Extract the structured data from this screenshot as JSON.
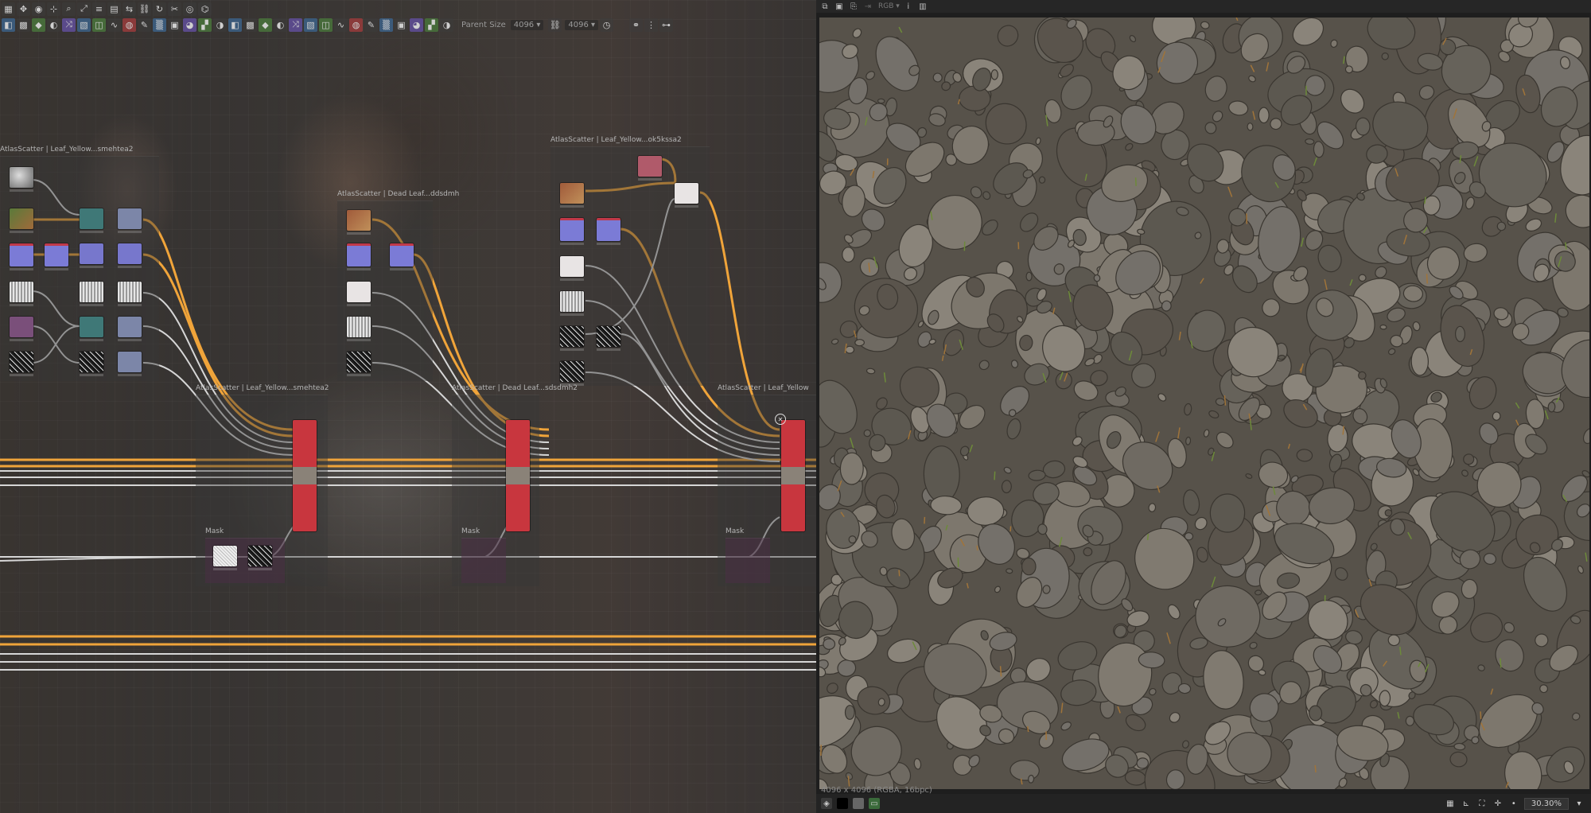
{
  "graph": {
    "toolbar": {
      "row1_icons": [
        "layout-icon",
        "move-icon",
        "camera-icon",
        "bookmark-icon",
        "search-icon",
        "fit-icon",
        "align-icon",
        "grid-icon",
        "arrow-icon",
        "link-icon",
        "refresh-icon",
        "cut-icon",
        "graph-icon",
        "pipe-icon"
      ],
      "row2_icons": [
        "image-icon",
        "texture-icon",
        "fill-icon",
        "blend-icon",
        "shuffle-icon",
        "gradient-icon",
        "levels-icon",
        "curve-icon",
        "warp-icon",
        "brush-icon",
        "noise-icon",
        "tile-icon",
        "color-icon",
        "pattern-icon",
        "hsl-icon",
        "mask-icon",
        "output-icon",
        "pixel-icon",
        "edit-icon",
        "text-icon",
        "frame-icon",
        "comment-icon",
        "pin-icon",
        "hdr-icon",
        "fx-icon",
        "sf-icon",
        "histogram-icon",
        "sharpen-icon",
        "blur-icon",
        "bake-icon"
      ],
      "parent_size_label": "Parent Size",
      "parent_size_value": "4096",
      "size_value": "4096"
    },
    "frames": [
      {
        "title": "AtlasScatter | Leaf_Yellow...smehtea2"
      },
      {
        "title": "AtlasScatter | Dead Leaf...ddsdmh"
      },
      {
        "title": "AtlasScatter | Leaf_Yellow...ok5kssa2"
      },
      {
        "title": "AtlasScatter | Leaf_Yellow...smehtea2"
      },
      {
        "title": "AtlasScatter | Dead Leaf...sdsdmh2"
      },
      {
        "title": "AtlasScatter | Leaf_Yellow"
      }
    ],
    "mask_frames": [
      {
        "title": "Mask"
      },
      {
        "title": "Mask"
      },
      {
        "title": "Mask"
      }
    ]
  },
  "viewer": {
    "toolbar_icons": [
      "copy-icon",
      "save-icon",
      "paste-icon",
      "export-icon",
      "channel-select-icon",
      "info-icon",
      "histogram-icon"
    ],
    "channel_select": "RGB",
    "resolution_text": "4096 x 4096 (RGBA, 16bpc)",
    "status_icons": [
      "layers-icon",
      "black-swatch-icon",
      "gray-swatch-icon",
      "display-icon"
    ],
    "right_icons": [
      "grid-icon",
      "ruler-icon",
      "fit-icon",
      "crosshair-icon",
      "dot-icon"
    ],
    "zoom": "30.30%"
  },
  "colors": {
    "wire_orange": "#f0a43a",
    "wire_white": "#d6d6d6",
    "atlas_red": "#c8363e",
    "background": "#303030"
  }
}
